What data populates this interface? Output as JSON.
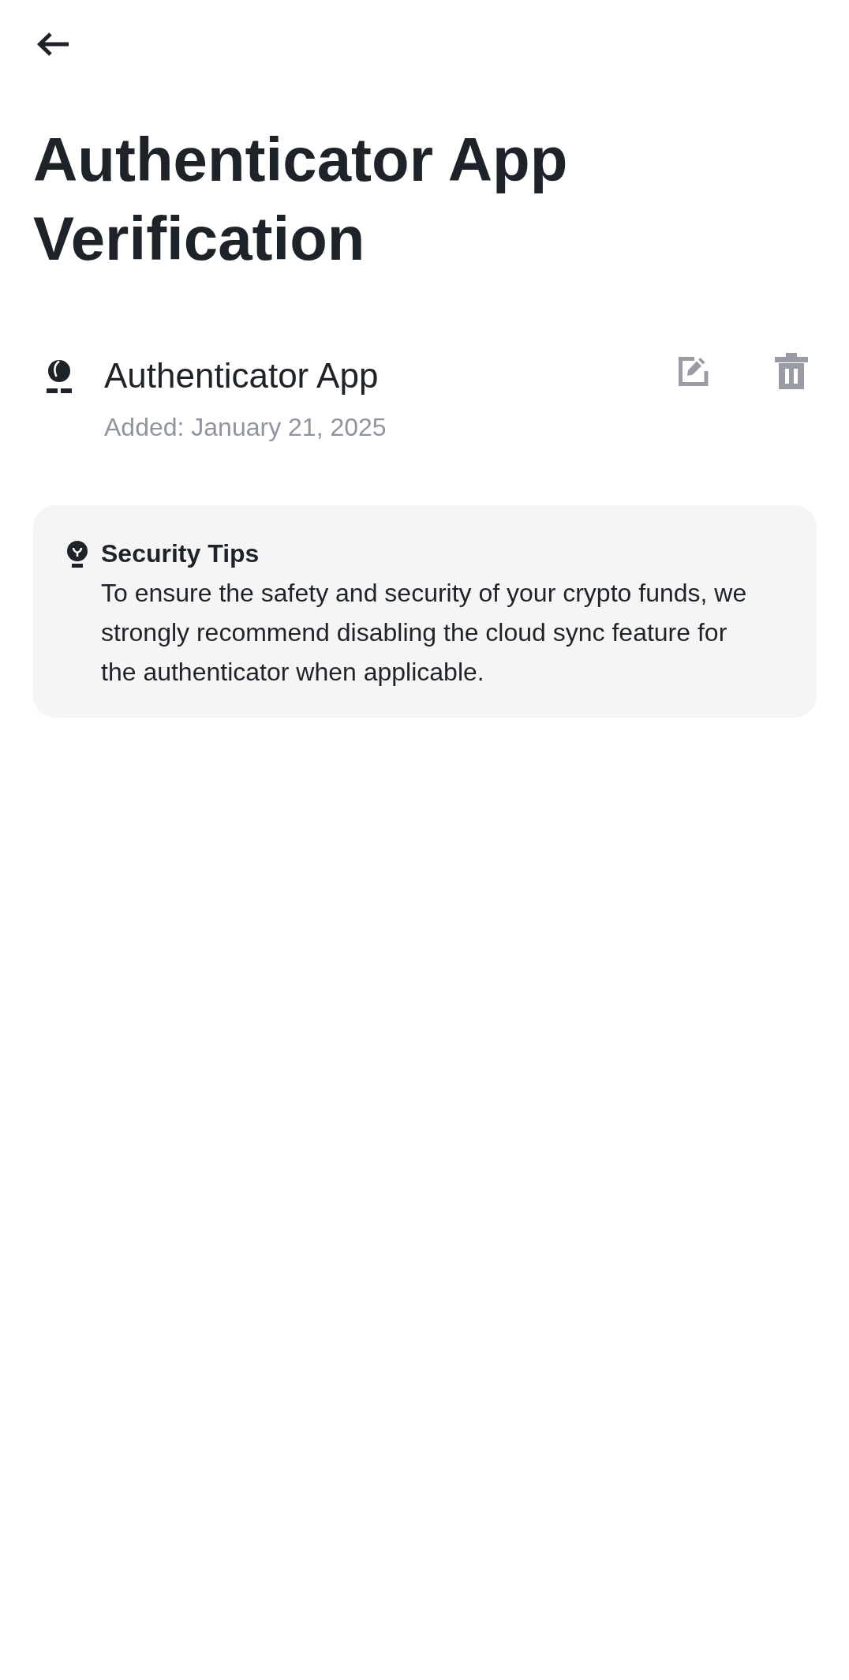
{
  "page": {
    "title": "Authenticator App Verification"
  },
  "authenticator": {
    "name": "Authenticator App",
    "added": "Added: January 21, 2025",
    "actions": [
      {
        "kind": "edit"
      },
      {
        "kind": "delete"
      }
    ]
  },
  "security_tips": {
    "title": "Security Tips",
    "text": "To ensure the safety and security of your crypto funds, we strongly recommend disabling the cloud sync feature for the authenticator when applicable."
  }
}
